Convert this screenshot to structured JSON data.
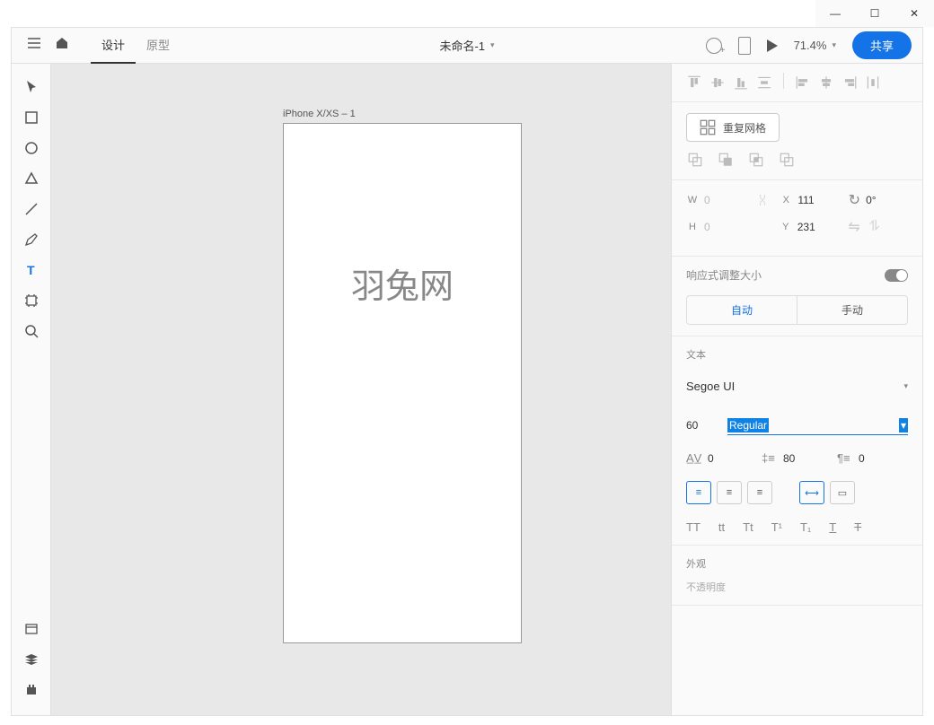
{
  "window": {
    "title_doc": "未命名-1"
  },
  "topbar": {
    "tab_design": "设计",
    "tab_prototype": "原型",
    "zoom": "71.4%",
    "share": "共享"
  },
  "canvas": {
    "artboard_name": "iPhone X/XS – 1",
    "sample_text": "羽兔网"
  },
  "panel": {
    "repeat_grid": "重复网格",
    "transform": {
      "w_label": "W",
      "w_val": "0",
      "h_label": "H",
      "h_val": "0",
      "x_label": "X",
      "x_val": "111",
      "y_label": "Y",
      "y_val": "231",
      "rotation": "0°"
    },
    "responsive": {
      "label": "响应式调整大小",
      "auto": "自动",
      "manual": "手动"
    },
    "text": {
      "label": "文本",
      "font": "Segoe UI",
      "size": "60",
      "weight": "Regular",
      "char_spacing": "0",
      "line_spacing": "80",
      "para_spacing": "0"
    },
    "appearance": {
      "label": "外观",
      "opacity_label": "不透明度"
    }
  }
}
